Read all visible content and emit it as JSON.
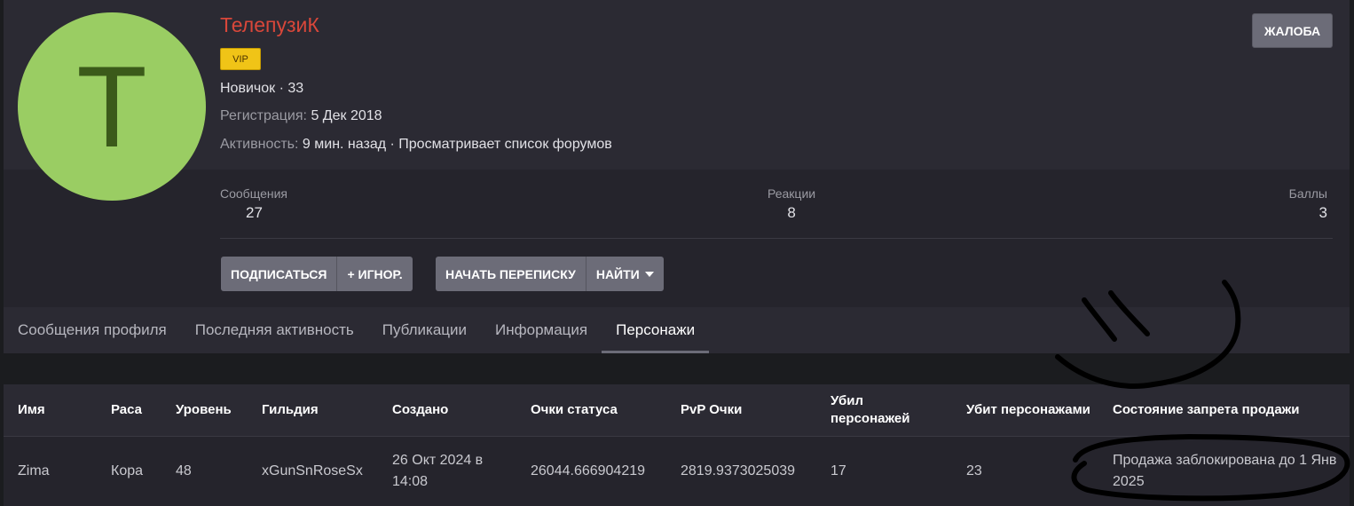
{
  "profile": {
    "avatar_letter": "T",
    "username": "ТелепузиК",
    "badge": "VIP",
    "rank_line": "Новичок · 33",
    "registration_label": "Регистрация:",
    "registration_value": "5 Дек 2018",
    "activity_label": "Активность:",
    "activity_value": "9 мин. назад · Просматривает список форумов",
    "report_button": "ЖАЛОБА",
    "stats": [
      {
        "label": "Сообщения",
        "value": "27"
      },
      {
        "label": "Реакции",
        "value": "8"
      },
      {
        "label": "Баллы",
        "value": "3"
      }
    ],
    "buttons": {
      "subscribe": "ПОДПИСАТЬСЯ",
      "ignore": "+ ИГНОР.",
      "start_conversation": "НАЧАТЬ ПЕРЕПИСКУ",
      "find": "НАЙТИ"
    }
  },
  "tabs": [
    {
      "label": "Сообщения профиля"
    },
    {
      "label": "Последняя активность"
    },
    {
      "label": "Публикации"
    },
    {
      "label": "Информация"
    },
    {
      "label": "Персонажи",
      "active": true
    }
  ],
  "characters_table": {
    "headers": [
      "Имя",
      "Раса",
      "Уровень",
      "Гильдия",
      "Создано",
      "Очки статуса",
      "PvP Очки",
      "Убил персонажей",
      "Убит персонажами",
      "Состояние запрета продажи"
    ],
    "rows": [
      [
        "Zima",
        "Кора",
        "48",
        "xGunSnRoseSx",
        "26 Окт 2024 в 14:08",
        "26044.666904219",
        "2819.9373025039",
        "17",
        "23",
        "Продажа заблокирована до 1 Янв 2025"
      ]
    ]
  },
  "colors": {
    "accent_name": "#d9473a",
    "avatar_bg": "#9acd63",
    "button_bg": "#6c6c78",
    "vip_bg": "#f0c417"
  }
}
